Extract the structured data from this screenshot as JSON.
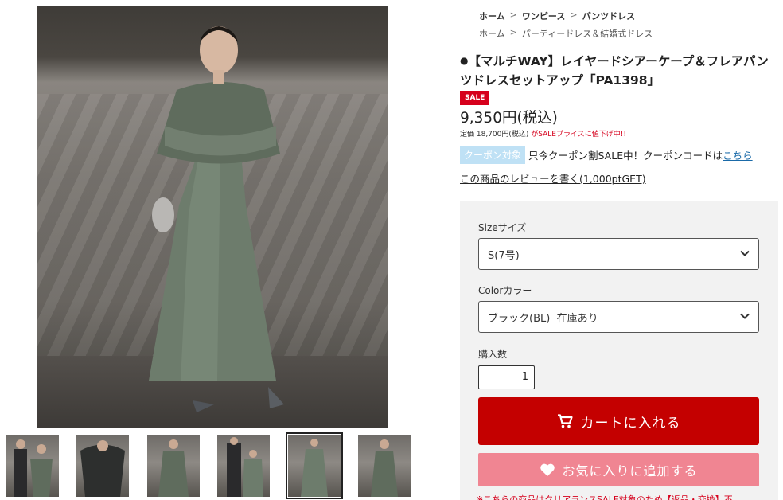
{
  "breadcrumb": {
    "row1": [
      {
        "label": "ホーム"
      },
      {
        "label": "ワンピース"
      },
      {
        "label": "パンツドレス"
      }
    ],
    "row2": [
      {
        "label": "ホーム"
      },
      {
        "label": "パーティードレス＆結婚式ドレス"
      }
    ],
    "separator": ">"
  },
  "product": {
    "title_bullet": "●",
    "title": "【マルチWAY】レイヤードシアーケープ＆フレアパンツドレスセットアップ「PA1398」",
    "sale_badge": "SALE",
    "price": "9,350円(税込)",
    "regular_price": "定価 18,700円(税込)",
    "regular_note": "がSALEプライスに値下げ中!!",
    "coupon_tag": "クーポン対象",
    "coupon_text": "只今クーポン割SALE中！クーポンコードは",
    "coupon_link": "こちら",
    "review_link": "この商品のレビューを書く(1,000ptGET)"
  },
  "purchase": {
    "size_label": "Sizeサイズ",
    "size_selected": "S(7号)",
    "color_label": "Colorカラー",
    "color_selected": "ブラック(BL)  在庫あり",
    "qty_label": "購入数",
    "qty_value": "1",
    "cart_button": "カートに入れる",
    "favorite_button": "お気に入りに追加する",
    "notice": "※こちらの商品はクリアランスSALE対象のため【返品・交換】不"
  },
  "gallery": {
    "thumbnail_count": 6,
    "active_thumbnail": 5
  },
  "colors": {
    "accent_red": "#c40000",
    "sale_red": "#d6001c",
    "favorite_pink": "#f08592",
    "coupon_blue": "#bfe1f5",
    "link_blue": "#1a6aa8"
  }
}
